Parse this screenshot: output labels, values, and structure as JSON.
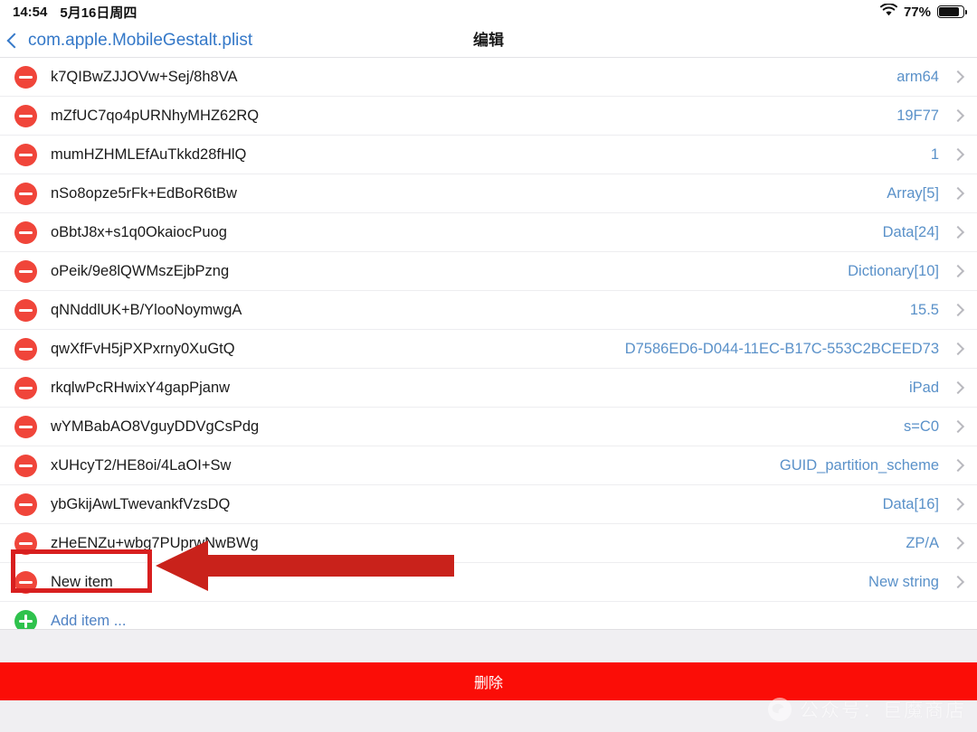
{
  "status_bar": {
    "time": "14:54",
    "date": "5月16日周四",
    "wifi_icon": "wifi-icon",
    "battery_percent": "77%",
    "battery_level": 77,
    "battery_icon": "battery-icon"
  },
  "nav": {
    "back_label": "com.apple.MobileGestalt.plist",
    "back_icon": "chevron-left-icon",
    "title": "编辑"
  },
  "list": {
    "delete_icon": "minus-circle-icon",
    "add_icon": "plus-circle-icon",
    "disclosure_icon": "chevron-right-icon",
    "rows": [
      {
        "key": "k7QIBwZJJOVw+Sej/8h8VA",
        "value": "arm64"
      },
      {
        "key": "mZfUC7qo4pURNhyMHZ62RQ",
        "value": "19F77"
      },
      {
        "key": "mumHZHMLEfAuTkkd28fHlQ",
        "value": "1"
      },
      {
        "key": "nSo8opze5rFk+EdBoR6tBw",
        "value": "Array[5]"
      },
      {
        "key": "oBbtJ8x+s1q0OkaiocPuog",
        "value": "Data[24]"
      },
      {
        "key": "oPeik/9e8lQWMszEjbPzng",
        "value": "Dictionary[10]"
      },
      {
        "key": "qNNddlUK+B/YlooNoymwgA",
        "value": "15.5"
      },
      {
        "key": "qwXfFvH5jPXPxrny0XuGtQ",
        "value": "D7586ED6-D044-11EC-B17C-553C2BCEED73"
      },
      {
        "key": "rkqlwPcRHwixY4gapPjanw",
        "value": "iPad"
      },
      {
        "key": "wYMBabAO8VguyDDVgCsPdg",
        "value": "s=C0"
      },
      {
        "key": "xUHcyT2/HE8oi/4LaOI+Sw",
        "value": "GUID_partition_scheme"
      },
      {
        "key": "ybGkijAwLTwevankfVzsDQ",
        "value": "Data[16]"
      },
      {
        "key": "zHeENZu+wbg7PUprwNwBWg",
        "value": "ZP/A"
      },
      {
        "key": "New item",
        "value": "New string"
      }
    ],
    "add_item_label": "Add item ..."
  },
  "footer": {
    "delete_label": "删除"
  },
  "annotation": {
    "highlight_target": "New item",
    "arrow_direction": "left",
    "color": "#d81f1f"
  },
  "watermark": {
    "text": "公众号：巨魔商店",
    "logo_icon": "wechat-icon"
  },
  "colors": {
    "accent_blue": "#3478c8",
    "value_blue": "#5a91c9",
    "delete_red": "#f0453a",
    "bar_red": "#fb0d07",
    "add_green": "#2fc24d",
    "annotation_red": "#d81f1f"
  }
}
